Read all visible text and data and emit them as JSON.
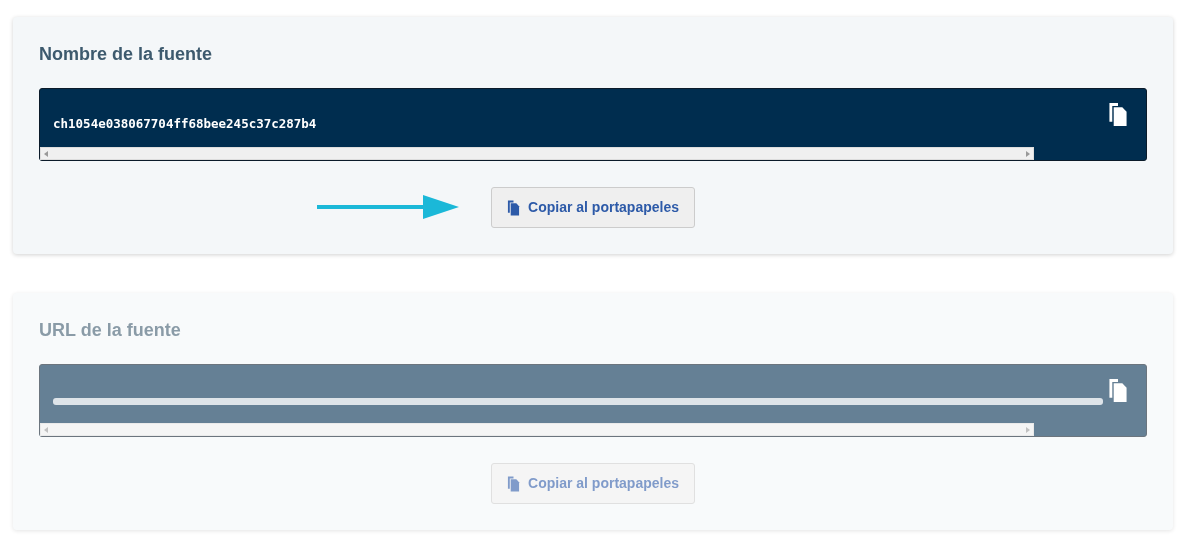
{
  "panels": [
    {
      "title": "Nombre de la fuente",
      "value": "ch1054e038067704ff68bee245c37c287b4",
      "button": "Copiar al portapapeles",
      "arrow": true,
      "dimmed": false
    },
    {
      "title": "URL de la fuente",
      "button": "Copiar al portapapeles",
      "arrow": false,
      "dimmed": true
    }
  ]
}
